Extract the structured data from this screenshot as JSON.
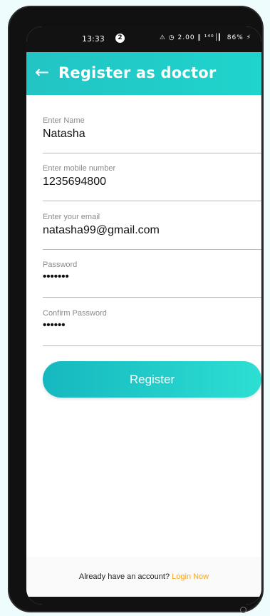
{
  "status_bar": {
    "time": "13:33",
    "notification_badge": "2",
    "icons_text": "⚠ ◷ 2.00 ‖ ¹⁴⁰│▎ 86% ⚡"
  },
  "app_bar": {
    "back_icon": "←",
    "title": "Register as doctor"
  },
  "form": {
    "fields": [
      {
        "label": "Enter Name",
        "value": "Natasha"
      },
      {
        "label": "Enter mobile number",
        "value": "1235694800"
      },
      {
        "label": "Enter your email",
        "value": "natasha99@gmail.com"
      },
      {
        "label": "Password",
        "value": "•••••••"
      },
      {
        "label": "Confirm Password",
        "value": "••••••"
      }
    ],
    "register_label": "Register"
  },
  "footer": {
    "text": "Already have an account? ",
    "link": "Login Now"
  },
  "colors": {
    "accent": "#1fc8c8",
    "link": "#f5a623"
  }
}
